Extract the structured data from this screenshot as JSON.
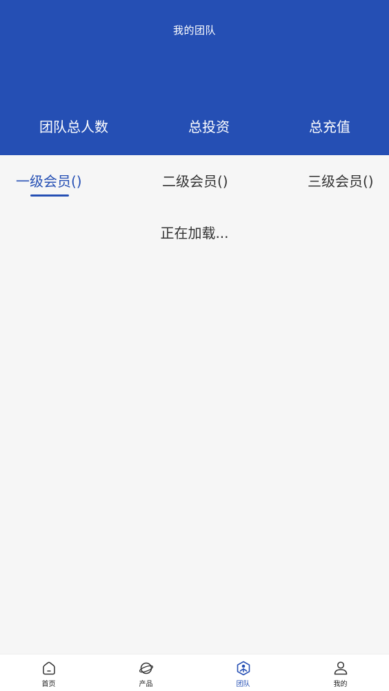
{
  "header": {
    "title": "我的团队",
    "stats": [
      {
        "label": "团队总人数"
      },
      {
        "label": "总投资"
      },
      {
        "label": "总充值"
      }
    ]
  },
  "tabs": [
    {
      "label": "一级会员()",
      "active": true
    },
    {
      "label": "二级会员()",
      "active": false
    },
    {
      "label": "三级会员()",
      "active": false
    }
  ],
  "content": {
    "loading_text": "正在加载..."
  },
  "bottom_nav": {
    "items": [
      {
        "label": "首页",
        "icon": "home-icon"
      },
      {
        "label": "产品",
        "icon": "planet-icon"
      },
      {
        "label": "团队",
        "icon": "team-icon",
        "active": true
      },
      {
        "label": "我的",
        "icon": "user-icon"
      }
    ]
  },
  "colors": {
    "primary": "#254fb4",
    "background": "#f6f6f6",
    "text": "#333333"
  }
}
